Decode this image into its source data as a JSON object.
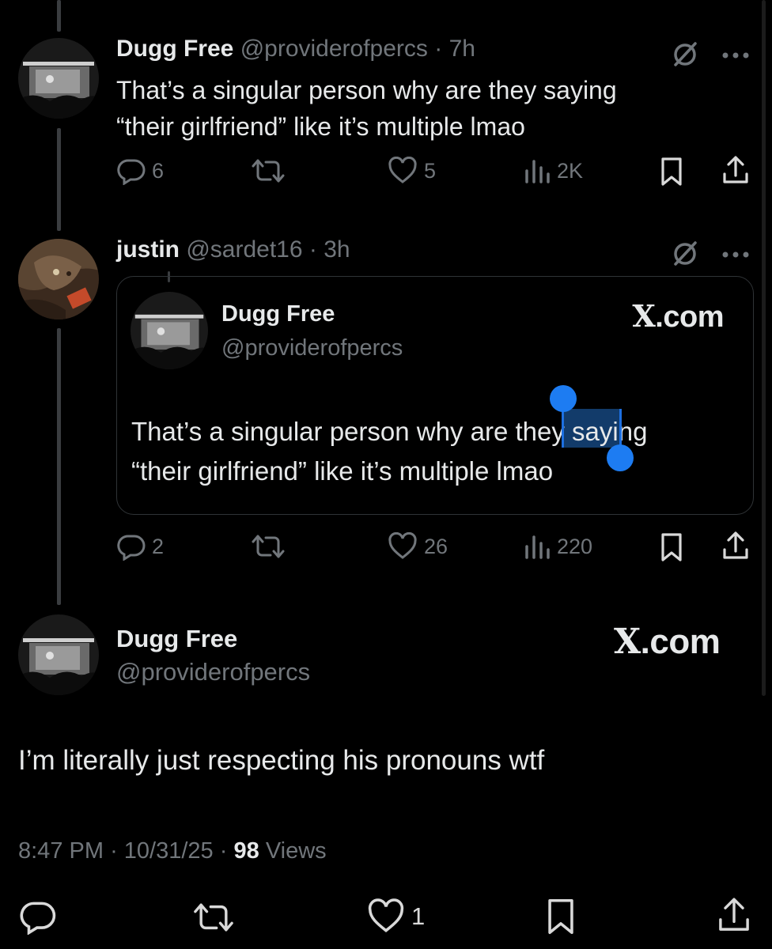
{
  "reply1": {
    "name": "Dugg Free",
    "handle": "@providerofpercs",
    "time": "7h",
    "text_line1": "That’s a singular person why are they saying",
    "text_line2": "“their girlfriend” like it’s multiple lmao",
    "replies": "6",
    "likes": "5",
    "views": "2K"
  },
  "reply2": {
    "name": "justin",
    "handle": "@sardet16",
    "time": "3h",
    "quote": {
      "name": "Dugg Free",
      "handle": "@providerofpercs",
      "brand": ".com",
      "brand_x": "X",
      "text_before": "That’s a singular person why are ",
      "text_selected": "they",
      "text_after": " saying",
      "text_line2": "“their girlfriend” like it’s multiple lmao"
    },
    "replies": "2",
    "likes": "26",
    "views": "220"
  },
  "main": {
    "name": "Dugg Free",
    "handle": "@providerofpercs",
    "brand_x": "X",
    "brand": ".com",
    "text": "I’m literally just respecting his pronouns wtf",
    "time": "8:47 PM",
    "date": "10/31/25",
    "views_count": "98",
    "views_label": "Views",
    "likes": "1"
  },
  "separator": "·",
  "colors": {
    "background": "#000000",
    "text": "#e7e9ea",
    "muted": "#71767b",
    "border": "#2f3336",
    "selection": "#1d7cf2"
  }
}
